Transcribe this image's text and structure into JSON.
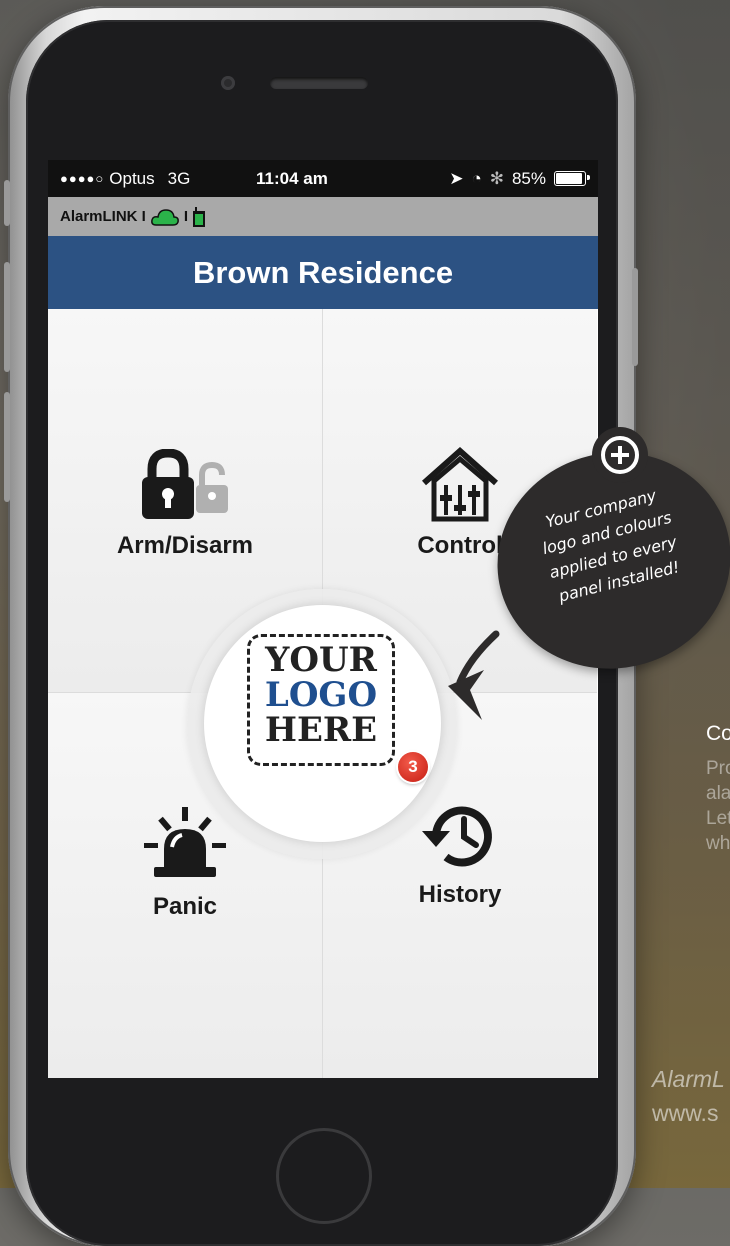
{
  "status_bar": {
    "carrier": "Optus",
    "network": "3G",
    "time": "11:04 am",
    "battery_percent": "85%",
    "battery_level": 0.85
  },
  "app_bar": {
    "label": "AlarmLINK I",
    "sep": "I",
    "cloud_color": "#2bb34a",
    "signal_color": "#2bb34a"
  },
  "header": {
    "title": "Brown Residence"
  },
  "tiles": {
    "arm": "Arm/Disarm",
    "control": "Control",
    "panic": "Panic",
    "history": "History"
  },
  "logo": {
    "line1": "YOUR",
    "line2": "LOGO",
    "line3": "HERE",
    "badge_count": "3"
  },
  "callout": {
    "line1": "Your company",
    "line2": "logo and colours",
    "line3": "applied to every",
    "line4": "panel installed!"
  },
  "side": {
    "title": "Co",
    "line1": "Pro",
    "line2": "ala",
    "line3": "Let",
    "line4": "wh",
    "footer1": "AlarmL",
    "footer2": "www.s"
  },
  "colors": {
    "header_bg": "#2c5283",
    "app_bar_bg": "#a9a9a9",
    "badge": "#d8281b"
  }
}
